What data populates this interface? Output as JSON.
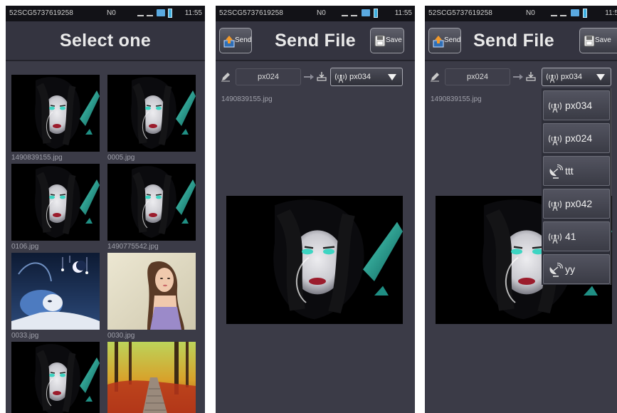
{
  "status_bar": {
    "device_id": "52SCG5737619258",
    "network": "N0",
    "time_full": "11:55",
    "time_clipped": "11:5"
  },
  "phone1": {
    "title": "Select one",
    "files": [
      {
        "name": "1490839155.jpg",
        "icon": "dark-face-thumbnail"
      },
      {
        "name": "0005.jpg",
        "icon": "dark-face-thumbnail"
      },
      {
        "name": "0106.jpg",
        "icon": "dark-face-thumbnail"
      },
      {
        "name": "1490775542.jpg",
        "icon": "dark-face-thumbnail"
      },
      {
        "name": "0033.jpg",
        "icon": "blue-fantasy-thumbnail"
      },
      {
        "name": "0030.jpg",
        "icon": "woman-portrait-thumbnail"
      },
      {
        "name": "",
        "icon": "dark-face-thumbnail"
      },
      {
        "name": "",
        "icon": "autumn-forest-path-thumbnail"
      }
    ]
  },
  "phone2": {
    "title": "Send File",
    "send_label": "Send",
    "save_label": "Save",
    "from_device": "px024",
    "to_device": "px034",
    "filename": "1490839155.jpg"
  },
  "phone3": {
    "title": "Send File",
    "send_label": "Send",
    "save_label": "Save",
    "from_device": "px024",
    "to_device": "px034",
    "filename": "1490839155.jpg",
    "dropdown_options": [
      {
        "label": "px034",
        "icon": "antenna-icon"
      },
      {
        "label": "px024",
        "icon": "antenna-icon"
      },
      {
        "label": "ttt",
        "icon": "satellite-dish-icon"
      },
      {
        "label": "px042",
        "icon": "antenna-icon"
      },
      {
        "label": "41",
        "icon": "antenna-icon"
      },
      {
        "label": "yy",
        "icon": "satellite-dish-icon"
      }
    ]
  },
  "colors": {
    "background": "#3b3b47",
    "statusbar": "#121217",
    "accent_teal": "#2fb7a6",
    "battery": "#3fb0e0"
  }
}
